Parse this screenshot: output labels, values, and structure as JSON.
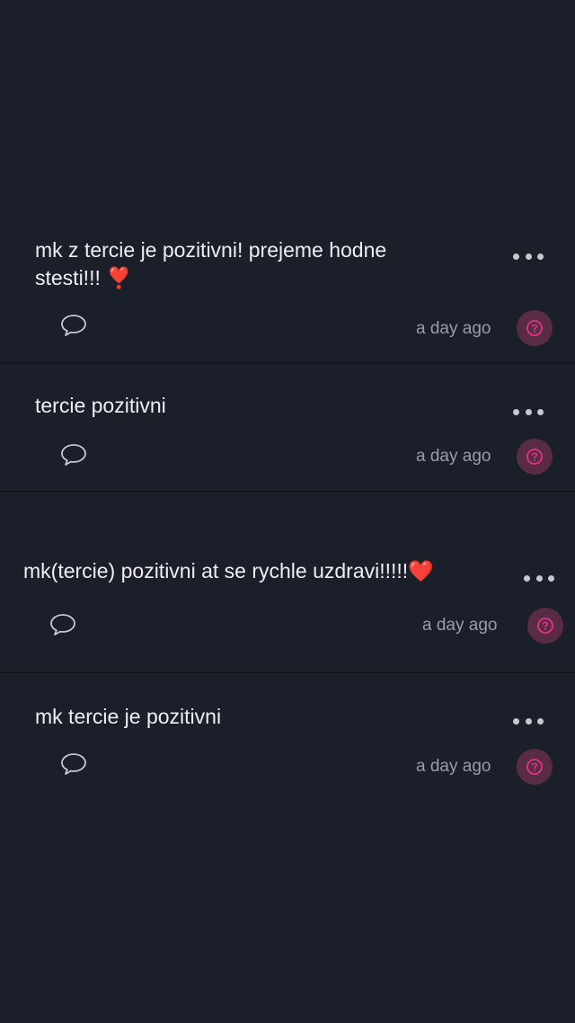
{
  "posts": [
    {
      "text": "mk z tercie je pozitivni! prejeme hodne\nstesti!!! ❣️",
      "time": "a day ago"
    },
    {
      "text": "tercie pozitivni",
      "time": "a day ago"
    },
    {
      "text": "mk(tercie) pozitivni at se rychle uzdravi!!!!!❤️",
      "time": "a day ago"
    },
    {
      "text": "mk tercie je pozitivni",
      "time": "a day ago"
    }
  ],
  "icons": {
    "comment": "comment-bubble-icon",
    "more": "more-dots-icon",
    "avatar": "anonymous-avatar-icon"
  },
  "colors": {
    "background": "#1b1f29",
    "avatar_bg": "#5a2c44",
    "avatar_fg": "#e0338a"
  }
}
